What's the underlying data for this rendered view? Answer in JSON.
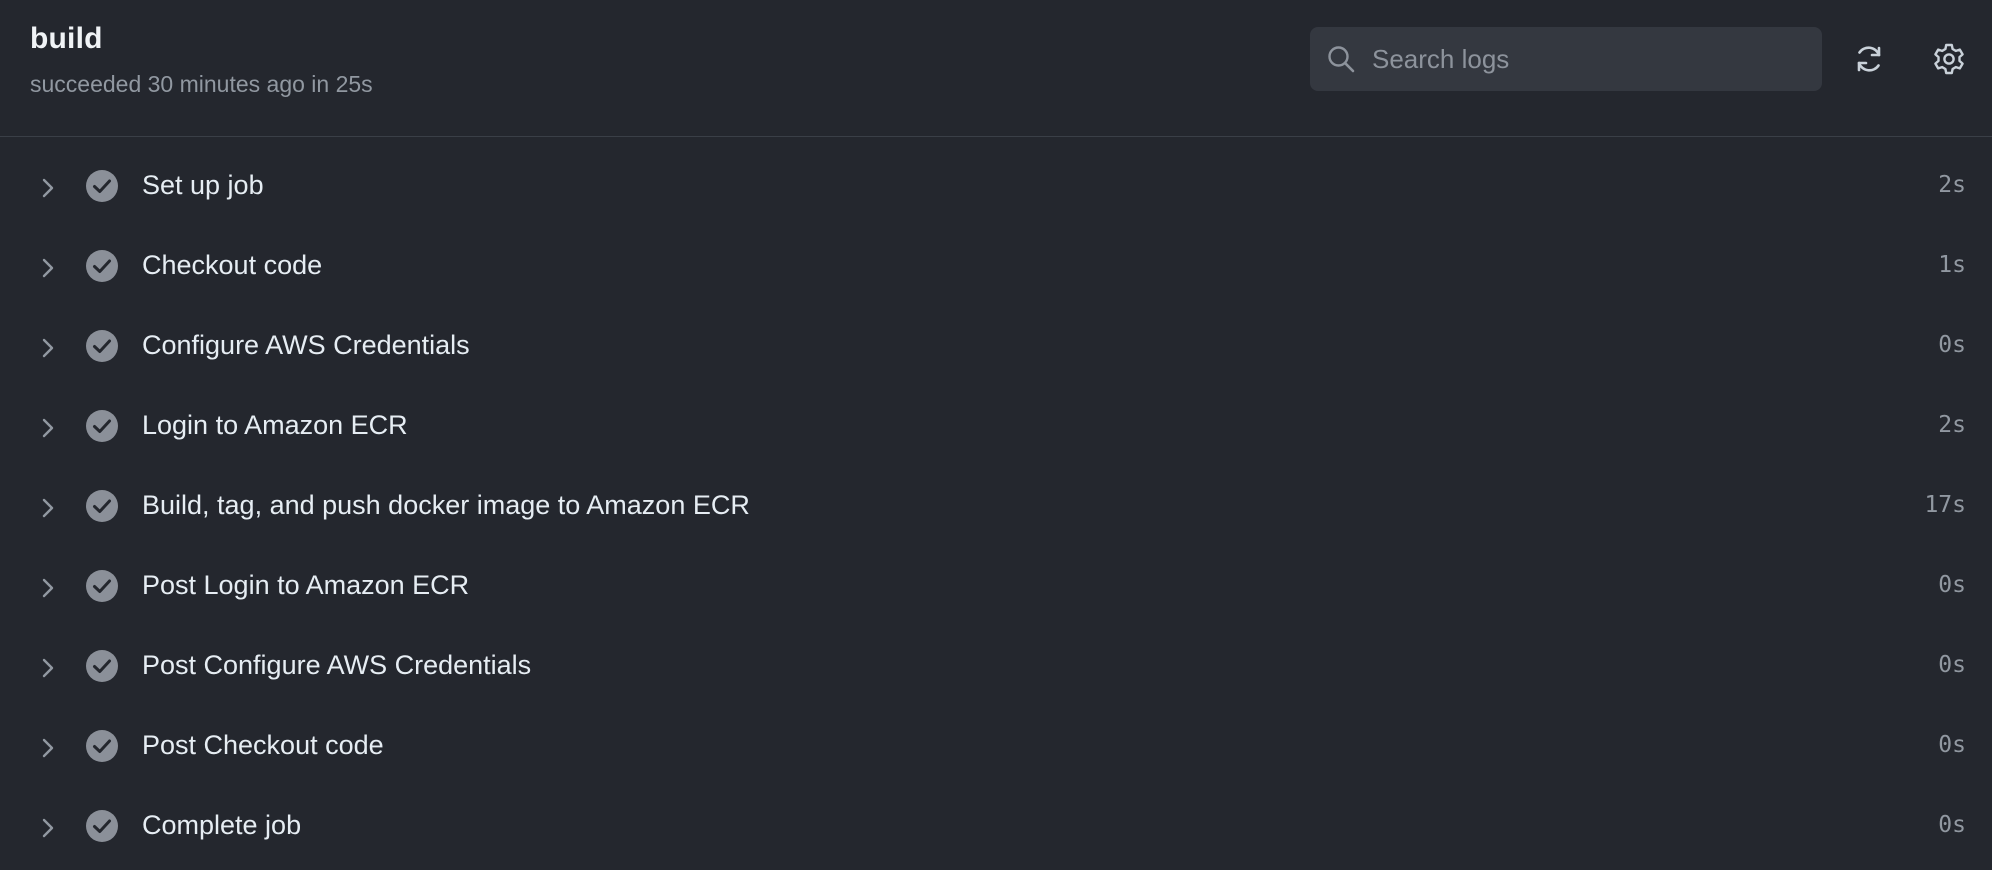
{
  "job": {
    "title": "build",
    "status": "succeeded 30 minutes ago in 25s"
  },
  "search": {
    "placeholder": "Search logs",
    "value": "",
    "icon": "search-icon"
  },
  "toolbar": {
    "refresh_icon": "refresh-icon",
    "settings_icon": "gear-icon"
  },
  "colors": {
    "background": "#24272e",
    "text": "#e6edf3",
    "muted": "#9198a1",
    "check": "#8b9099"
  },
  "steps": [
    {
      "name": "Set up job",
      "duration": "2s",
      "status": "success"
    },
    {
      "name": "Checkout code",
      "duration": "1s",
      "status": "success"
    },
    {
      "name": "Configure AWS Credentials",
      "duration": "0s",
      "status": "success"
    },
    {
      "name": "Login to Amazon ECR",
      "duration": "2s",
      "status": "success"
    },
    {
      "name": "Build, tag, and push docker image to Amazon ECR",
      "duration": "17s",
      "status": "success"
    },
    {
      "name": "Post Login to Amazon ECR",
      "duration": "0s",
      "status": "success"
    },
    {
      "name": "Post Configure AWS Credentials",
      "duration": "0s",
      "status": "success"
    },
    {
      "name": "Post Checkout code",
      "duration": "0s",
      "status": "success"
    },
    {
      "name": "Complete job",
      "duration": "0s",
      "status": "success"
    }
  ]
}
